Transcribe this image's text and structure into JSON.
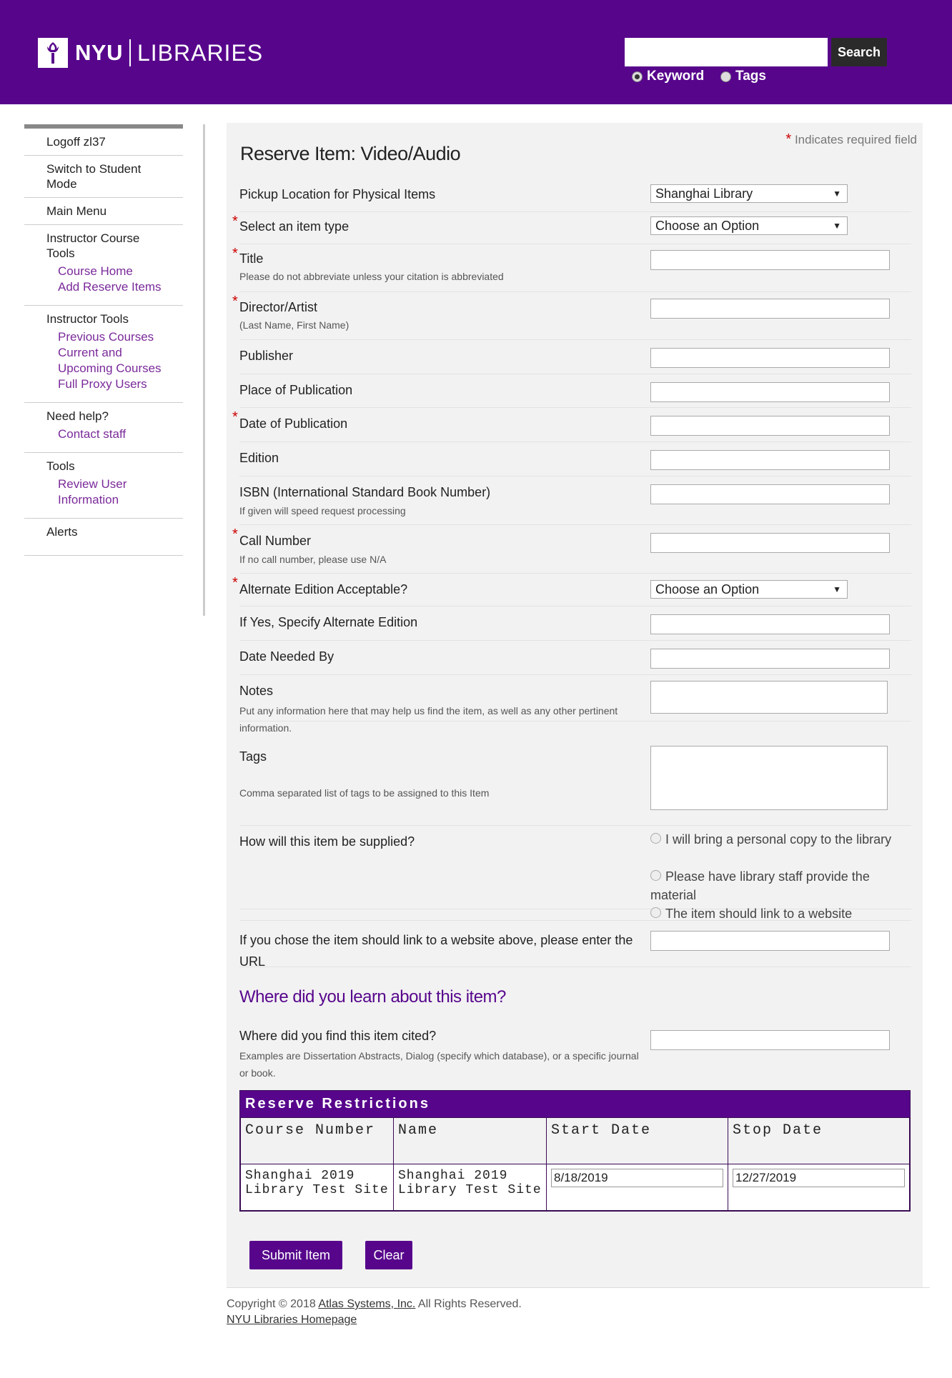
{
  "header": {
    "logo_nyu": "NYU",
    "logo_libraries": "LIBRARIES",
    "search_placeholder": "",
    "search_button": "Search",
    "radio_keyword": "Keyword",
    "radio_tags": "Tags",
    "radio_selected": "Keyword",
    "brand_color": "#57068c"
  },
  "sidebar": {
    "logoff": "Logoff zl37",
    "switch_mode": "Switch to Student Mode",
    "main_menu": "Main Menu",
    "instructor_course_tools": "Instructor Course Tools",
    "course_home": "Course Home",
    "add_reserve_items": "Add Reserve Items",
    "instructor_tools": "Instructor Tools",
    "previous_courses": "Previous Courses",
    "current_upcoming": "Current and Upcoming Courses",
    "full_proxy": "Full Proxy Users",
    "need_help": "Need help?",
    "contact_staff": "Contact staff",
    "tools": "Tools",
    "review_user": "Review User Information",
    "alerts": "Alerts"
  },
  "form": {
    "required_note": "Indicates required field",
    "title": "Reserve Item: Video/Audio",
    "pickup_label": "Pickup Location for Physical Items",
    "pickup_value": "Shanghai Library",
    "item_type_label": "Select an item type",
    "item_type_value": "Choose an Option",
    "title_label": "Title",
    "title_hint": "Please do not abbreviate unless your citation is abbreviated",
    "director_label": "Director/Artist",
    "director_hint": "(Last Name, First Name)",
    "publisher_label": "Publisher",
    "place_label": "Place of Publication",
    "date_pub_label": "Date of Publication",
    "edition_label": "Edition",
    "isbn_label": "ISBN (International Standard Book Number)",
    "isbn_hint": "If given will speed request processing",
    "call_label": "Call Number",
    "call_hint": "If no call number, please use N/A",
    "alt_label": "Alternate Edition Acceptable?",
    "alt_value": "Choose an Option",
    "alt_specify_label": "If Yes, Specify Alternate Edition",
    "date_needed_label": "Date Needed By",
    "notes_label": "Notes",
    "notes_hint": "Put any information here that may help us find the item, as well as any other pertinent information.",
    "tags_label": "Tags",
    "tags_hint": "Comma separated list of tags to be assigned to this Item",
    "supply_label": "How will this item be supplied?",
    "supply_options": [
      "I will bring a personal copy to the library",
      "Please have library staff provide the material",
      "The item should link to a website"
    ],
    "url_label": "If you chose the item should link to a website above, please enter the URL",
    "learn_heading": "Where did you learn about this item?",
    "cited_label": "Where did you find this item cited?",
    "cited_hint": "Examples are Dissertation Abstracts, Dialog (specify which database), or a specific journal or book."
  },
  "restrictions": {
    "title": "Reserve Restrictions",
    "headers": [
      "Course Number",
      "Name",
      "Start Date",
      "Stop Date"
    ],
    "course_number": "Shanghai 2019 Library Test Site",
    "name": "Shanghai 2019 Library Test Site",
    "start_date": "8/18/2019",
    "stop_date": "12/27/2019"
  },
  "buttons": {
    "submit": "Submit Item",
    "clear": "Clear"
  },
  "footer": {
    "copyright_prefix": "Copyright © 2018",
    "atlas_link": "Atlas Systems, Inc.",
    "copyright_suffix": "All Rights Reserved.",
    "homepage_link": "NYU Libraries Homepage"
  }
}
